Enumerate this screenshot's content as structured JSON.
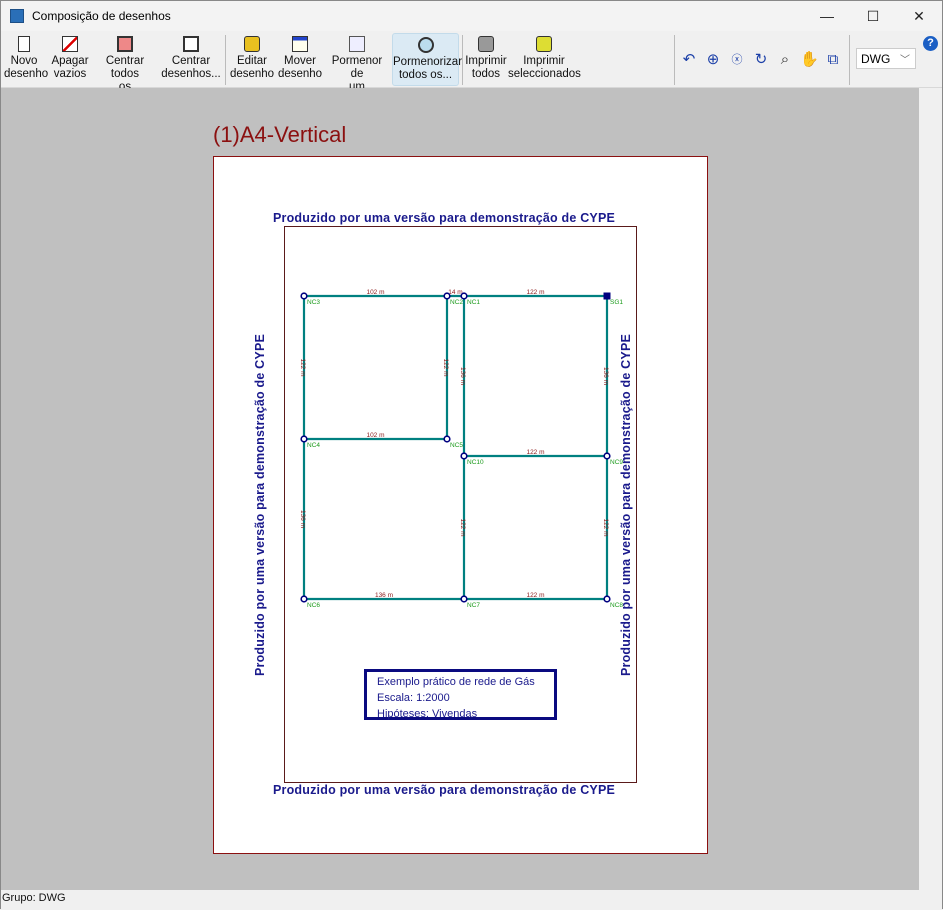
{
  "window": {
    "title": "Composição de desenhos",
    "minimize": "—",
    "maximize": "☐",
    "close": "✕"
  },
  "toolbar": {
    "buttons": [
      {
        "label1": "Novo",
        "label2": "desenho",
        "icon": "new-drawing-icon"
      },
      {
        "label1": "Apagar",
        "label2": "vazios",
        "icon": "delete-empty-icon"
      },
      {
        "label1": "Centrar todos",
        "label2": "os desenhos",
        "icon": "center-all-icon"
      },
      {
        "label1": "Centrar",
        "label2": "desenhos...",
        "icon": "center-drawings-icon"
      },
      {
        "label1": "Editar",
        "label2": "desenho",
        "icon": "edit-drawing-icon"
      },
      {
        "label1": "Mover",
        "label2": "desenho",
        "icon": "move-drawing-icon"
      },
      {
        "label1": "Pormenor de",
        "label2": "um desenho",
        "icon": "detail-drawing-icon"
      },
      {
        "label1": "Pormenorizar",
        "label2": "todos os...",
        "icon": "detail-all-icon"
      },
      {
        "label1": "Imprimir",
        "label2": "todos",
        "icon": "print-all-icon"
      },
      {
        "label1": "Imprimir",
        "label2": "seleccionados",
        "icon": "print-selected-icon"
      }
    ],
    "format_select": "DWG",
    "help": "?"
  },
  "sheet": {
    "title": "(1)A4-Vertical",
    "watermark": "Produzido por uma versão para demonstração de CYPE",
    "legend": [
      "Exemplo prático de rede de Gás",
      "Escala: 1:2000",
      "Hipóteses: Vivendas"
    ]
  },
  "network": {
    "colors": {
      "pipe": "#008080",
      "node": "#000080",
      "node_label": "#1a9a1a",
      "length_label": "#8b1a1a"
    },
    "nodes": [
      "NC3",
      "NC2",
      "NC1",
      "SG1",
      "NC4",
      "NC5",
      "NC10",
      "NC9",
      "NC6",
      "NC7",
      "NC8"
    ],
    "edges": [
      {
        "from": "NC3",
        "to": "NC2",
        "label": "102 m"
      },
      {
        "from": "NC2",
        "to": "NC1",
        "label": "14 m"
      },
      {
        "from": "NC1",
        "to": "SG1",
        "label": "122 m"
      },
      {
        "from": "NC3",
        "to": "NC4",
        "label": "122 m"
      },
      {
        "from": "NC2",
        "to": "NC5",
        "label": "122 m"
      },
      {
        "from": "NC1",
        "to": "NC10",
        "label": "136 m"
      },
      {
        "from": "SG1",
        "to": "NC9",
        "label": "136 m"
      },
      {
        "from": "NC4",
        "to": "NC5",
        "label": "102 m"
      },
      {
        "from": "NC10",
        "to": "NC9",
        "label": "122 m"
      },
      {
        "from": "NC4",
        "to": "NC6",
        "label": "136 m"
      },
      {
        "from": "NC10",
        "to": "NC7",
        "label": "122 m"
      },
      {
        "from": "NC9",
        "to": "NC8",
        "label": "122 m"
      },
      {
        "from": "NC6",
        "to": "NC7",
        "label": "136 m"
      },
      {
        "from": "NC7",
        "to": "NC8",
        "label": "122 m"
      }
    ]
  },
  "status": {
    "text": "Grupo: DWG"
  }
}
